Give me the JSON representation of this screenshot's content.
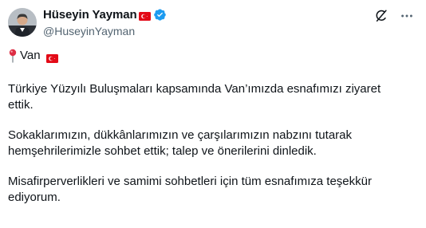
{
  "user": {
    "display_name": "Hüseyin Yayman",
    "handle": "@HuseyinYayman",
    "flag": "turkey-flag-icon",
    "verified": "verified-badge-icon"
  },
  "actions": {
    "grok_icon": "grok-icon",
    "more_icon": "more-options-icon"
  },
  "tweet": {
    "location": "Van",
    "paragraphs": [
      "Türkiye Yüzyılı Buluşmaları kapsamında Van’ımızda esnafımızı ziyaret ettik.",
      "Sokaklarımızın, dükkânlarımızın ve çarşılarımızın nabzını tutarak hemşehrilerimizle sohbet ettik; talep ve önerilerini dinledik.",
      "Misafirperverlikleri ve samimi sohbetleri için tüm esnafımıza teşekkür ediyorum."
    ]
  },
  "colors": {
    "text": "#0f1419",
    "secondary": "#536471",
    "verified": "#1d9bf0",
    "flag_red": "#e30a17"
  }
}
